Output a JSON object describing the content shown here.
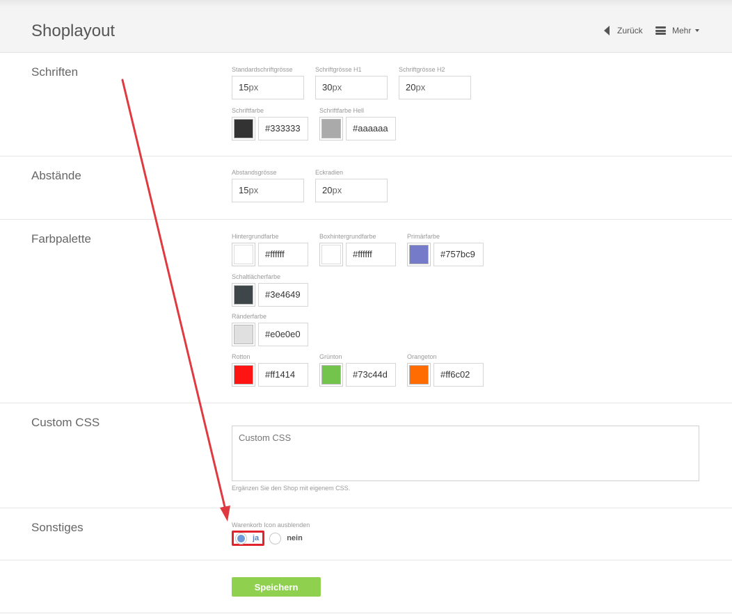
{
  "header": {
    "title": "Shoplayout",
    "back_label": "Zurück",
    "more_label": "Mehr"
  },
  "sections": {
    "schriften": {
      "label": "Schriften",
      "standard_size": {
        "label": "Standardschriftgrösse",
        "value": "15",
        "unit": "px"
      },
      "h1_size": {
        "label": "Schriftgrösse H1",
        "value": "30",
        "unit": "px"
      },
      "h2_size": {
        "label": "Schriftgrösse H2",
        "value": "20",
        "unit": "px"
      },
      "font_color": {
        "label": "Schriftfarbe",
        "value": "#333333"
      },
      "font_color_light": {
        "label": "Schriftfarbe Hell",
        "value": "#aaaaaa"
      }
    },
    "abstaende": {
      "label": "Abstände",
      "spacing": {
        "label": "Abstandsgrösse",
        "value": "15",
        "unit": "px"
      },
      "radius": {
        "label": "Eckradien",
        "value": "20",
        "unit": "px"
      }
    },
    "farbpalette": {
      "label": "Farbpalette",
      "background": {
        "label": "Hintergrundfarbe",
        "value": "#ffffff"
      },
      "box_background": {
        "label": "Boxhintergrundfarbe",
        "value": "#ffffff"
      },
      "primary": {
        "label": "Primärfarbe",
        "value": "#757bc9"
      },
      "button": {
        "label": "Schaltlächerfarbe",
        "value": "#3e4649"
      },
      "border": {
        "label": "Ränderfarbe",
        "value": "#e0e0e0"
      },
      "red": {
        "label": "Rotton",
        "value": "#ff1414"
      },
      "green": {
        "label": "Grünton",
        "value": "#73c44d"
      },
      "orange": {
        "label": "Orangeton",
        "value": "#ff6c02"
      }
    },
    "custom_css": {
      "label": "Custom CSS",
      "placeholder": "Custom CSS",
      "help": "Ergänzen Sie den Shop mit eigenem CSS."
    },
    "sonstiges": {
      "label": "Sonstiges",
      "cart_icon": {
        "label": "Warenkorb Icon ausblenden",
        "yes_label": "ja",
        "no_label": "nein",
        "selected": "ja"
      }
    }
  },
  "actions": {
    "save_label": "Speichern"
  },
  "colors": {
    "save_button": "#8fd14f",
    "annotation_red": "#e0242d",
    "radio_selected": "#6e9bd8"
  }
}
